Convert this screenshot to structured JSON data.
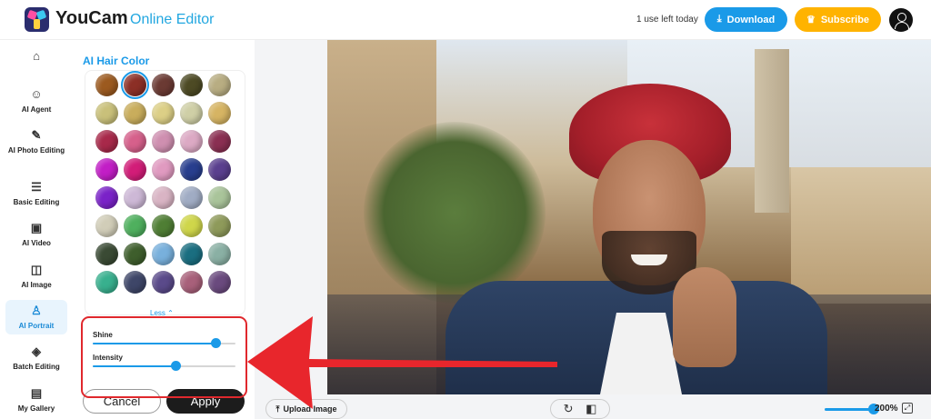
{
  "header": {
    "brand": "YouCam",
    "brand_sub": "Online Editor",
    "uses_left": "1 use left today",
    "download_label": "Download",
    "subscribe_label": "Subscribe"
  },
  "nav": {
    "items": [
      {
        "label": "",
        "icon": "home-icon"
      },
      {
        "label": "AI Agent",
        "icon": "robot-icon"
      },
      {
        "label": "AI Photo Editing",
        "icon": "magic-wand-icon"
      },
      {
        "label": "Basic Editing",
        "icon": "sliders-icon"
      },
      {
        "label": "AI Video",
        "icon": "video-icon"
      },
      {
        "label": "AI Image",
        "icon": "image-sparkle-icon"
      },
      {
        "label": "AI Portrait",
        "icon": "portrait-icon",
        "active": true
      },
      {
        "label": "Batch Editing",
        "icon": "layers-icon"
      },
      {
        "label": "My Gallery",
        "icon": "gallery-icon"
      }
    ]
  },
  "panel": {
    "title": "AI Hair Color",
    "less_label": "Less",
    "swatches": [
      "#9c5a1f",
      "#8c2f26",
      "#6b3a33",
      "#4d4a24",
      "#b8ad82",
      "#c9c07a",
      "#c9ad5c",
      "#dccf86",
      "#cfcfa6",
      "#d6b463",
      "#a8294a",
      "#d6608b",
      "#cf8fb0",
      "#dca9c4",
      "#8a2f52",
      "#c21ec6",
      "#d21d78",
      "#e09ac0",
      "#283e8e",
      "#5a3f8e",
      "#7a22c8",
      "#cdb8d6",
      "#d9b4c4",
      "#a0acc4",
      "#a9c49a",
      "#d1cdb8",
      "#4fb05e",
      "#4f7e34",
      "#cfd64a",
      "#8e9a5a",
      "#3a4a34",
      "#3e5e2c",
      "#78b0dc",
      "#1a6e80",
      "#8ab0a4",
      "#38b08e",
      "#3e4668",
      "#5a4a8a",
      "#a8607a",
      "#6a4a7e"
    ],
    "selected_swatch": "#8c2f26",
    "shine_label": "Shine",
    "shine_value": 0.86,
    "intensity_label": "Intensity",
    "intensity_value": 0.58,
    "cancel_label": "Cancel",
    "apply_label": "Apply"
  },
  "canvas": {
    "upload_label": "Upload Image",
    "zoom_label": "200%",
    "zoom_value": 1.0
  },
  "colors": {
    "accent": "#1a9ae8",
    "subscribe": "#ffb300",
    "highlight": "#e0282d"
  }
}
